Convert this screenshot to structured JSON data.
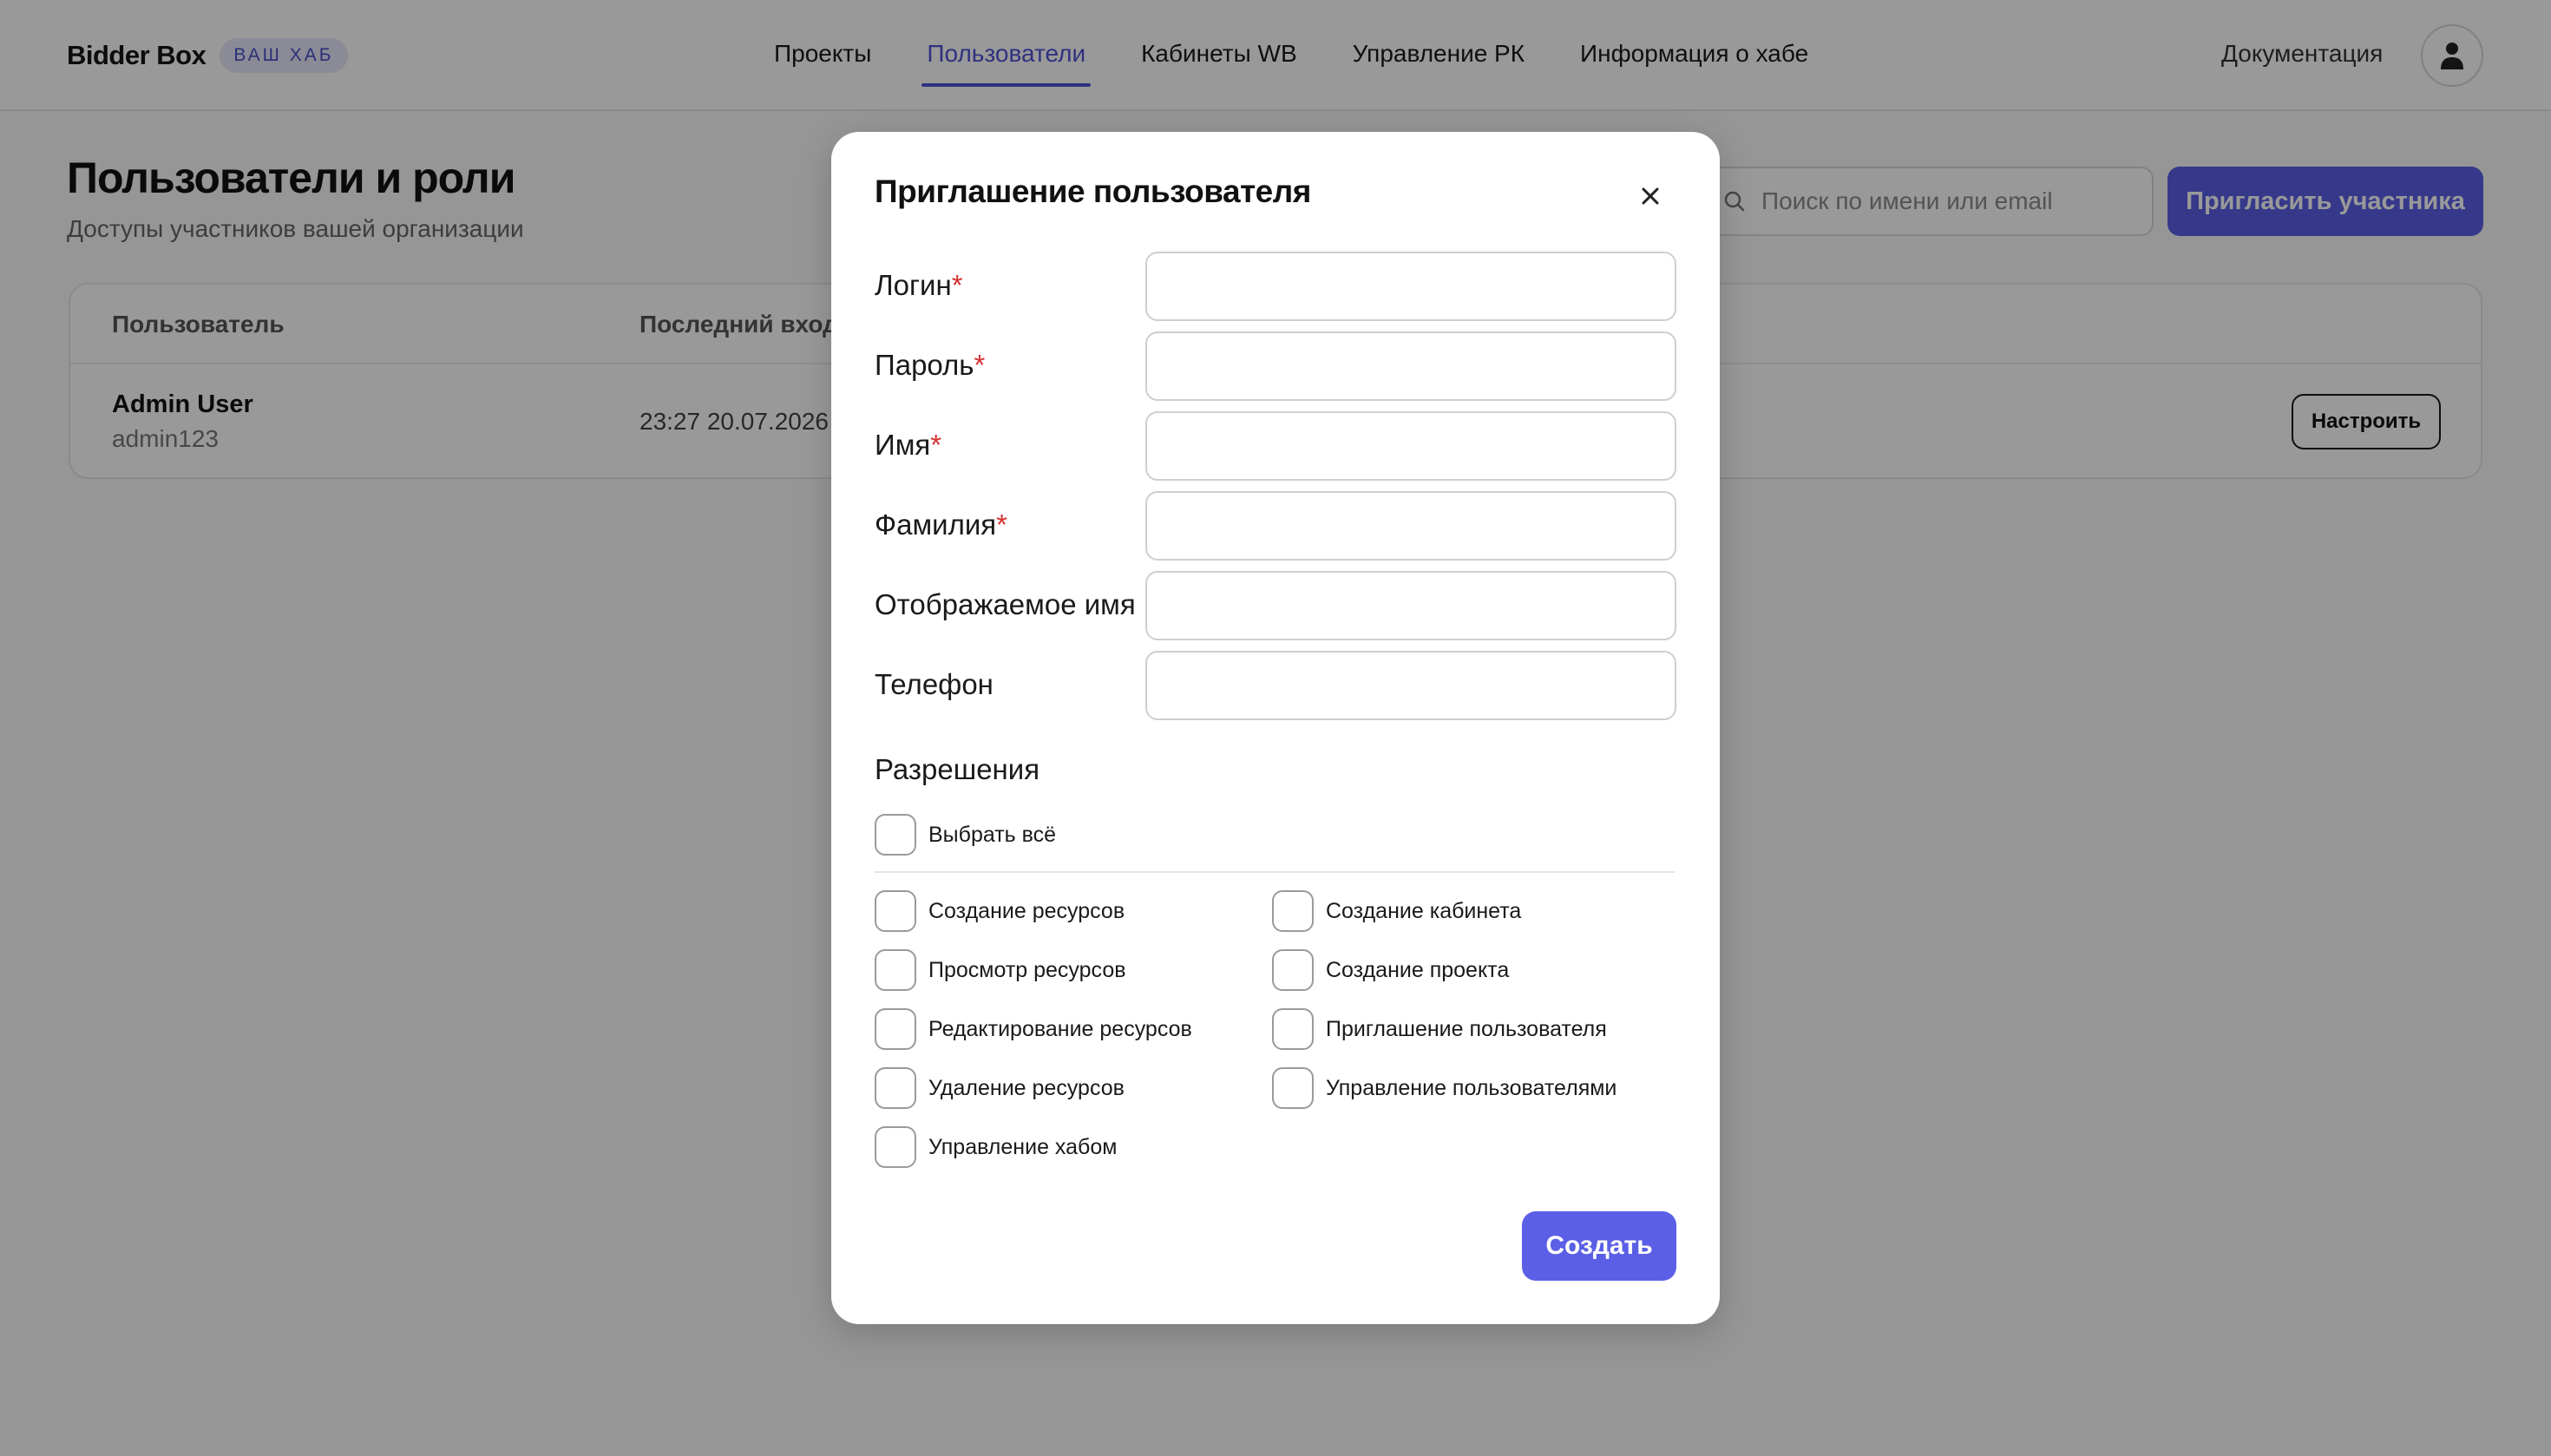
{
  "header": {
    "brand": "Bidder Box",
    "hub_badge": "ВАШ ХАБ",
    "nav": [
      {
        "label": "Проекты"
      },
      {
        "label": "Пользователи"
      },
      {
        "label": "Кабинеты WB"
      },
      {
        "label": "Управление РК"
      },
      {
        "label": "Информация о хабе"
      }
    ],
    "active_nav": "Пользователи",
    "docs_link": "Документация"
  },
  "page": {
    "title": "Пользователи и роли",
    "subtitle": "Доступы участников вашей организации",
    "search_placeholder": "Поиск по имени или email",
    "invite_button": "Пригласить участника"
  },
  "table": {
    "columns": [
      "Пользователь",
      "Последний вход"
    ],
    "rows": [
      {
        "name": "Admin User",
        "login": "admin123",
        "last_login": "23:27 20.07.2026",
        "action": "Настроить"
      }
    ]
  },
  "modal": {
    "title": "Приглашение пользователя",
    "fields": [
      {
        "label": "Логин",
        "required": true,
        "value": ""
      },
      {
        "label": "Пароль",
        "required": true,
        "value": ""
      },
      {
        "label": "Имя",
        "required": true,
        "value": ""
      },
      {
        "label": "Фамилия",
        "required": true,
        "value": ""
      },
      {
        "label": "Отображаемое имя",
        "required": false,
        "value": ""
      },
      {
        "label": "Телефон",
        "required": false,
        "value": ""
      }
    ],
    "required_mark": "*",
    "permissions_title": "Разрешения",
    "select_all": "Выбрать всё",
    "permissions_left": [
      "Создание ресурсов",
      "Просмотр ресурсов",
      "Редактирование ресурсов",
      "Удаление ресурсов",
      "Управление хабом"
    ],
    "permissions_right": [
      "Создание кабинета",
      "Создание проекта",
      "Приглашение пользователя",
      "Управление пользователями"
    ],
    "submit_button": "Создать"
  },
  "colors": {
    "accent": "#5b5fe6",
    "required": "#d43030",
    "overlay": "rgba(0,0,0,0.40)"
  },
  "icons": {
    "search": "search-icon",
    "close": "close-icon",
    "avatar": "user-icon"
  }
}
